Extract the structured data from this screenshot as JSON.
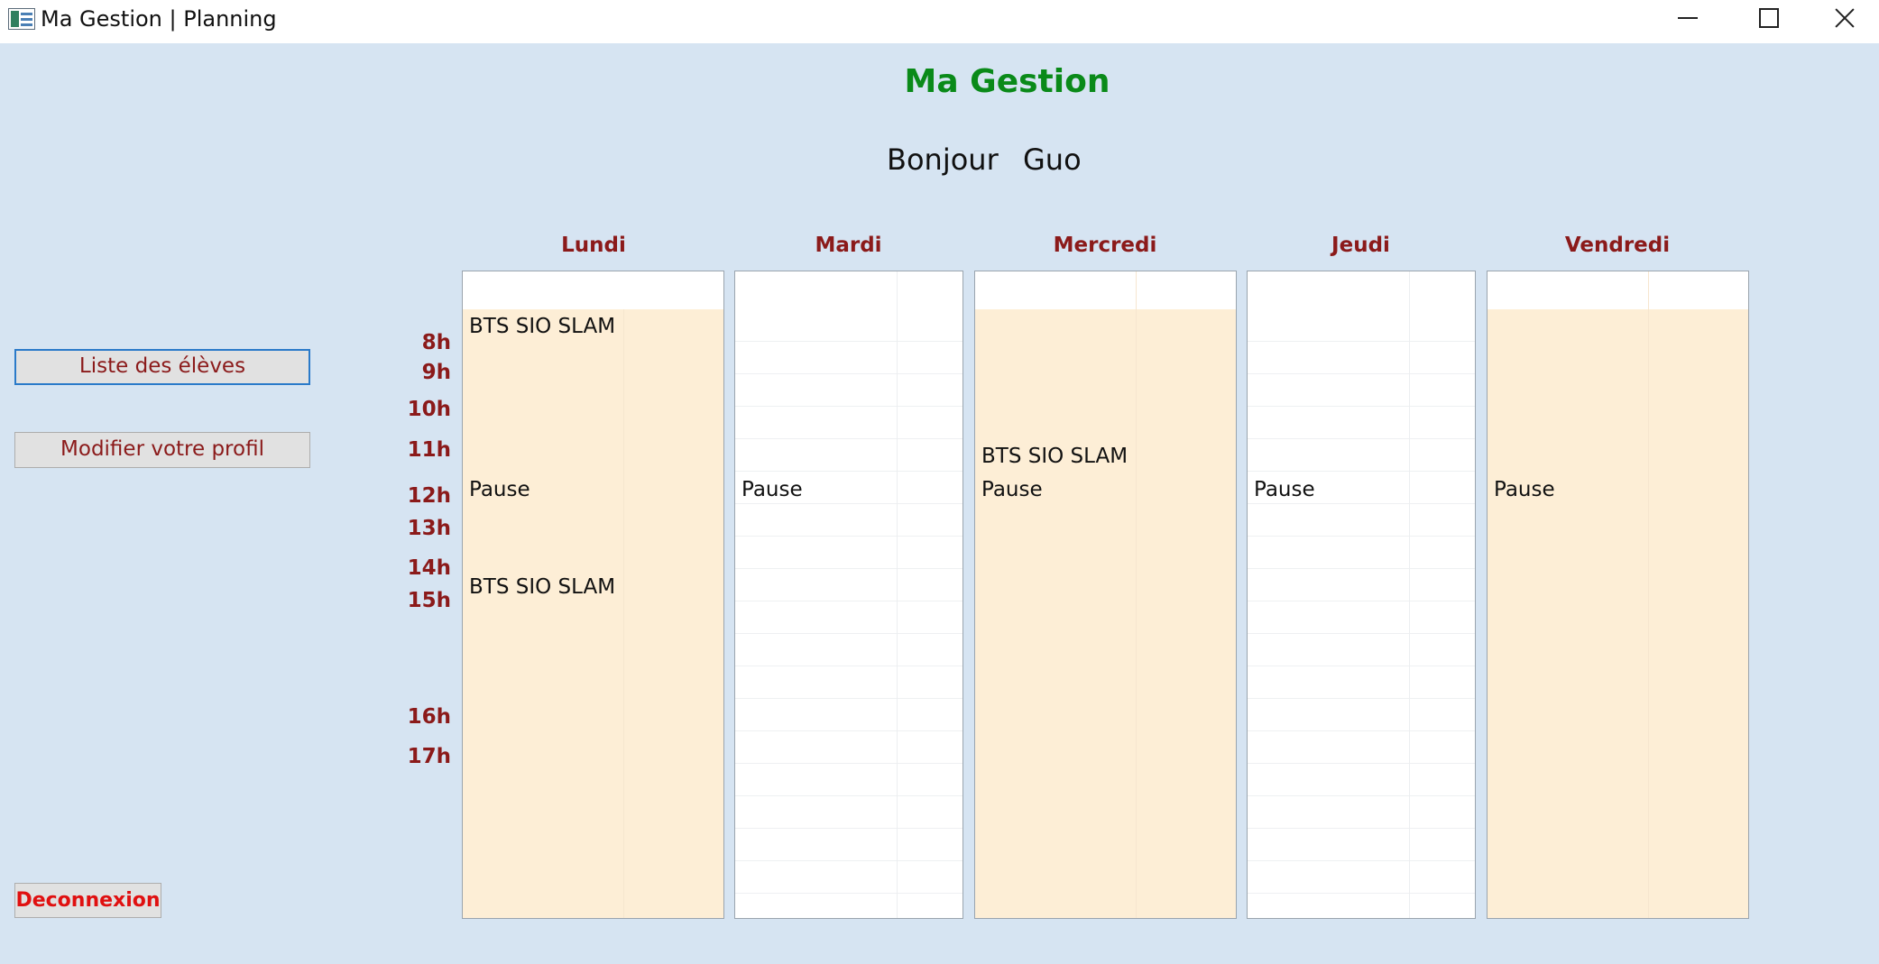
{
  "window": {
    "title": "Ma Gestion | Planning",
    "icon": "app-icon"
  },
  "header": {
    "app_name": "Ma Gestion",
    "greeting": "Bonjour",
    "user_name": "Guo"
  },
  "sidebar": {
    "students_button": "Liste des élèves",
    "profile_button": "Modifier votre profil",
    "logout_button": "Deconnexion"
  },
  "hours": [
    "8h",
    "9h",
    "10h",
    "11h",
    "12h",
    "13h",
    "14h",
    "15h",
    "16h",
    "17h"
  ],
  "days": [
    {
      "name": "Lundi",
      "entries": [
        "BTS SIO SLAM",
        "Pause",
        "BTS SIO SLAM"
      ]
    },
    {
      "name": "Mardi",
      "entries": [
        "Pause"
      ]
    },
    {
      "name": "Mercredi",
      "entries": [
        "BTS SIO SLAM",
        "Pause"
      ]
    },
    {
      "name": "Jeudi",
      "entries": [
        "Pause"
      ]
    },
    {
      "name": "Vendredi",
      "entries": [
        "Pause"
      ]
    }
  ],
  "colors": {
    "background": "#d6e4f2",
    "heading_green": "#0a8a19",
    "label_red": "#8b1a1a",
    "logout_red": "#e01010",
    "slot_fill": "#fdeed6"
  }
}
